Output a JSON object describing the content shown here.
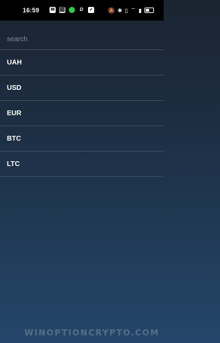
{
  "status_bar": {
    "time": "16:59",
    "app_icons": [
      "app-icon-1",
      "app-icon-2",
      "app-icon-3",
      "app-icon-4"
    ],
    "system_icons": [
      "mute-icon",
      "bluetooth-icon",
      "vibrate-icon",
      "wifi-icon",
      "signal-icon",
      "battery-icon"
    ]
  },
  "search": {
    "placeholder": "search",
    "value": ""
  },
  "currencies": [
    {
      "label": "UAH"
    },
    {
      "label": "USD"
    },
    {
      "label": "EUR"
    },
    {
      "label": "BTC"
    },
    {
      "label": "LTC"
    }
  ],
  "watermark": "WINOPTIONCRYPTO.COM",
  "colors": {
    "background_top": "#1b2431",
    "background_bottom": "#24466a",
    "divider": "#3d4c60",
    "placeholder": "#7e8ea3"
  }
}
